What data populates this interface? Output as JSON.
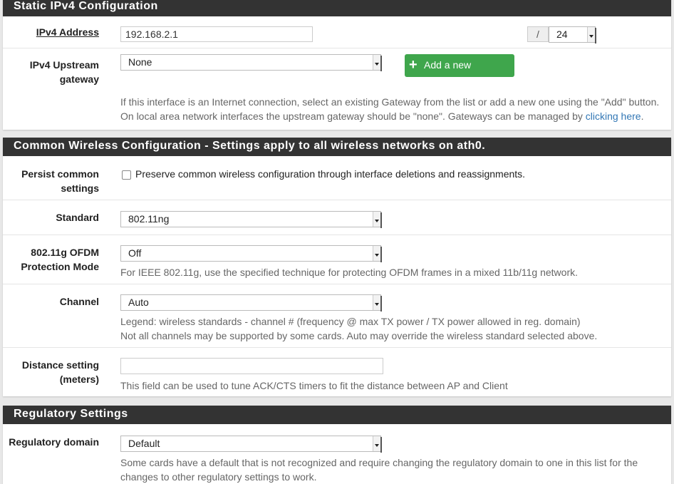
{
  "sections": {
    "static_ipv4": {
      "title": "Static IPv4 Configuration",
      "ipv4_address_label": "IPv4 Address",
      "ipv4_address_value": "192.168.2.1",
      "cidr_separator": "/",
      "cidr_value": "24",
      "upstream_label_1": "IPv4 Upstream",
      "upstream_label_2": "gateway",
      "upstream_value": "None",
      "add_gateway_label": "Add a new gateway",
      "help_line_1": "If this interface is an Internet connection, select an existing Gateway from the list or add a new one using the \"Add\" button.",
      "help_line_2_prefix": "On local area network interfaces the upstream gateway should be \"none\". Gateways can be managed by ",
      "help_link": "clicking here",
      "help_line_2_suffix": "."
    },
    "wireless": {
      "title": "Common Wireless Configuration - Settings apply to all wireless networks on ath0.",
      "persist_label_1": "Persist common",
      "persist_label_2": "settings",
      "persist_text": "Preserve common wireless configuration through interface deletions and reassignments.",
      "standard_label": "Standard",
      "standard_value": "802.11ng",
      "ofdm_label_1": "802.11g OFDM",
      "ofdm_label_2": "Protection Mode",
      "ofdm_value": "Off",
      "ofdm_help": "For IEEE 802.11g, use the specified technique for protecting OFDM frames in a mixed 11b/11g network.",
      "channel_label": "Channel",
      "channel_value": "Auto",
      "channel_help_1": "Legend: wireless standards - channel # (frequency @ max TX power / TX power allowed in reg. domain)",
      "channel_help_2": "Not all channels may be supported by some cards. Auto may override the wireless standard selected above.",
      "distance_label_1": "Distance setting",
      "distance_label_2": "(meters)",
      "distance_value": "",
      "distance_help": "This field can be used to tune ACK/CTS timers to fit the distance between AP and Client"
    },
    "regulatory": {
      "title": "Regulatory Settings",
      "domain_label": "Regulatory domain",
      "domain_value": "Default",
      "help_1": "Some cards have a default that is not recognized and require changing the regulatory domain to one in this list for the",
      "help_2": "changes to other regulatory settings to work."
    }
  },
  "colors": {
    "panel_header_bg": "#333333",
    "button_green": "#3fa64c",
    "link_blue": "#3277b5"
  },
  "icons": {
    "add_gateway": "plus-icon",
    "select_arrow": "chevron-down-icon"
  }
}
